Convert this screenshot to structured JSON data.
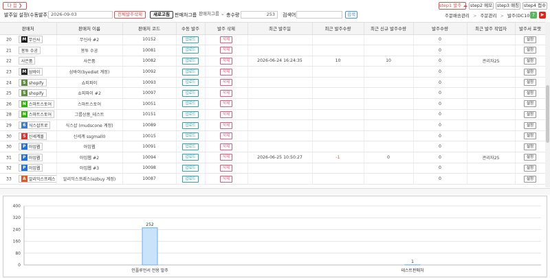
{
  "toolbar": {
    "next_label": "다 음",
    "order_date_setting_label": "발주일 설정(수동발주)",
    "date_value": "2026-09-03",
    "delete_all_label": "전체발주삭제",
    "refresh_label": "새로고침",
    "seller_group_label": "판매처그룹",
    "seller_group_select": "판매처그룹",
    "total_qty_label": "총수량",
    "total_qty_value": "253",
    "search_label": "검색어",
    "search_value": "",
    "search_button": "검색"
  },
  "steps": {
    "step1": "step1 발주",
    "step2": "step2 메모",
    "step3": "step3 매칭",
    "step4": "step4 접수"
  },
  "breadcrumb": {
    "item1": "주문배송관리",
    "sep1": ">",
    "item2": "주문관리",
    "sep2": ">",
    "current": "발주(DC10)"
  },
  "icons": {
    "help": "?",
    "youtube": "▶",
    "next_arrow": "❯"
  },
  "table": {
    "headers": [
      "판매처",
      "판매처 이름",
      "판매처 코드",
      "수동 발주",
      "발주 삭제",
      "최근 발주일",
      "최근 발주수량",
      "최근 신규 발주수량",
      "발주수량",
      "최근 발주 작업자",
      "발주서 포맷"
    ],
    "upload_label": "업로드",
    "delete_label": "삭제",
    "setting_label": "설정",
    "rows": [
      {
        "no": "20",
        "logo": "무신사",
        "logo_mark": "M",
        "logo_color": "#111111",
        "name": "무신사 #2",
        "code": "10152",
        "date": "",
        "recent_qty": "",
        "recent_new": "",
        "qty": "0",
        "worker": ""
      },
      {
        "no": "21",
        "logo": "봉투 수공",
        "logo_mark": "",
        "logo_color": "",
        "name": "봉투 수공",
        "code": "10081",
        "date": "",
        "recent_qty": "",
        "recent_new": "",
        "qty": "0",
        "worker": ""
      },
      {
        "no": "22",
        "logo": "사은품",
        "logo_mark": "",
        "logo_color": "",
        "name": "사은품",
        "code": "10082",
        "date": "2026-06-24 16:24:35",
        "recent_qty": "10",
        "recent_new": "10",
        "qty": "0",
        "worker": "관리자25"
      },
      {
        "no": "23",
        "logo": "삼바이",
        "logo_mark": "M",
        "logo_color": "#222222",
        "name": "삼바이(byediet 계정)",
        "code": "10092",
        "date": "",
        "recent_qty": "",
        "recent_new": "",
        "qty": "0",
        "worker": ""
      },
      {
        "no": "24",
        "logo": "shopify",
        "logo_mark": "S",
        "logo_color": "#5e8e3e",
        "name": "쇼피파이",
        "code": "10093",
        "date": "",
        "recent_qty": "",
        "recent_new": "",
        "qty": "0",
        "worker": ""
      },
      {
        "no": "25",
        "logo": "shopify",
        "logo_mark": "S",
        "logo_color": "#5e8e3e",
        "name": "쇼피파이 #2",
        "code": "10097",
        "date": "",
        "recent_qty": "",
        "recent_new": "",
        "qty": "0",
        "worker": ""
      },
      {
        "no": "26",
        "logo": "스마트스토어",
        "logo_mark": "N",
        "logo_color": "#2db400",
        "name": "스마트스토어",
        "code": "10051",
        "date": "",
        "recent_qty": "",
        "recent_new": "",
        "qty": "0",
        "worker": ""
      },
      {
        "no": "28",
        "logo": "스마트스토어",
        "logo_mark": "N",
        "logo_color": "#2db400",
        "name": "그룹상품_테스트",
        "code": "10151",
        "date": "",
        "recent_qty": "",
        "recent_new": "",
        "qty": "0",
        "worker": ""
      },
      {
        "no": "29",
        "logo": "식스샵프로",
        "logo_mark": "6",
        "logo_color": "#3a7bd5",
        "name": "식스샵 (mudscone 계정)",
        "code": "10089",
        "date": "",
        "recent_qty": "",
        "recent_new": "",
        "qty": "0",
        "worker": ""
      },
      {
        "no": "30",
        "logo": "신세계몰",
        "logo_mark": "S",
        "logo_color": "#e0312d",
        "name": "신세계 ssgmall0",
        "code": "10015",
        "date": "",
        "recent_qty": "",
        "recent_new": "",
        "qty": "0",
        "worker": ""
      },
      {
        "no": "30",
        "logo": "아임웹",
        "logo_mark": "P",
        "logo_color": "#1f6fe5",
        "name": "아임웹",
        "code": "10091",
        "date": "",
        "recent_qty": "",
        "recent_new": "",
        "qty": "0",
        "worker": ""
      },
      {
        "no": "31",
        "logo": "아임웹",
        "logo_mark": "P",
        "logo_color": "#1f6fe5",
        "name": "아임웹 #2",
        "code": "10094",
        "date": "2026-06-25 10:50:27",
        "recent_qty": "-1",
        "recent_new": "0",
        "qty": "0",
        "worker": "관리자25"
      },
      {
        "no": "32",
        "logo": "아임웹",
        "logo_mark": "P",
        "logo_color": "#1f6fe5",
        "name": "아임웹 #3",
        "code": "10098",
        "date": "",
        "recent_qty": "",
        "recent_new": "",
        "qty": "0",
        "worker": ""
      },
      {
        "no": "33",
        "logo": "알리익스프레스",
        "logo_mark": "A",
        "logo_color": "#e8541e",
        "name": "알리익스프레스(ezbuy 계정)",
        "code": "10087",
        "date": "",
        "recent_qty": "",
        "recent_new": "",
        "qty": "0",
        "worker": ""
      }
    ]
  },
  "chart_data": {
    "type": "bar",
    "categories": [
      "인플루언서 전용 발주",
      "테스트판매처"
    ],
    "values": [
      252,
      1
    ],
    "ylim": [
      0,
      400
    ],
    "yticks": [
      0,
      80,
      160,
      240,
      320,
      400
    ],
    "bar_color": "#c9e3fb",
    "bar_border": "#6aaee8",
    "grid": true
  }
}
